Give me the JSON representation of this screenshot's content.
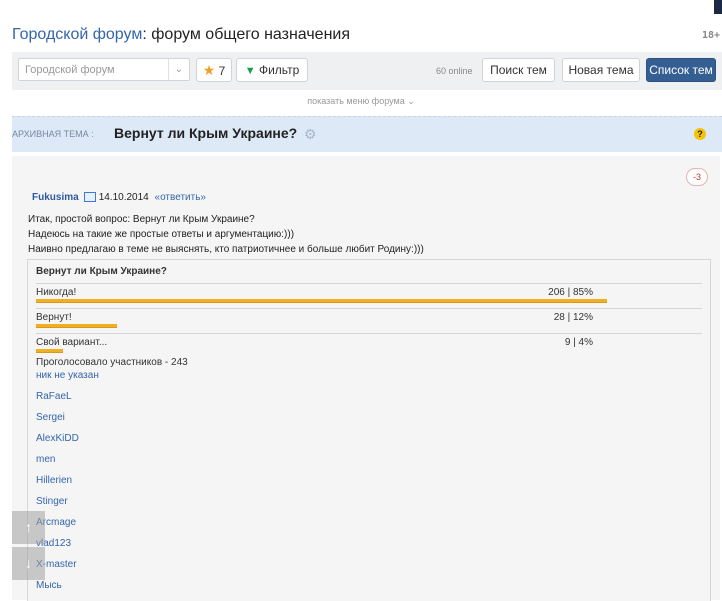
{
  "header": {
    "forum_link": "Городской форум",
    "separator": ":",
    "subtitle": "форум общего назначения",
    "age": "18+"
  },
  "toolbar": {
    "forum_select_value": "Городской форум",
    "favorites_count": "7",
    "filter_label": "Фильтр",
    "online": "60 online",
    "search_label": "Поиск тем",
    "new_topic_label": "Новая тема",
    "topic_list_label": "Список тем"
  },
  "show_menu": "показать меню форума",
  "topic": {
    "archive_label": "АРХИВНАЯ ТЕМА :",
    "title": "Вернут ли Крым Украине?",
    "help": "?"
  },
  "post": {
    "rating": "-3",
    "author": "Fukusima",
    "date": "14.10.2014",
    "reply": "«ответить»",
    "lines": [
      "Итак, простой вопрос: Вернут ли Крым Украине?",
      "Надеюсь на такие же простые ответы и аргументацию:)))",
      "Наивно предлагаю в теме не выяснять, кто патриотичнее и больше любит Родину:)))"
    ]
  },
  "poll": {
    "question": "Вернут ли Крым Украине?",
    "options": [
      {
        "label": "Никогда!",
        "result": "206 | 85%",
        "percent": 85
      },
      {
        "label": "Вернут!",
        "result": "28 | 12%",
        "percent": 12
      },
      {
        "label": "Свой вариант...",
        "result": "9 | 4%",
        "percent": 4
      }
    ],
    "voted": "Проголосовало участников - 243",
    "voters": [
      "ник не указан",
      "RaFaeL",
      "Sergei",
      "AlexKiDD",
      "men",
      "Hillerien",
      "Stinger",
      "Arcmage",
      "vlad123",
      "X-master",
      "Мысь"
    ]
  },
  "icons": {
    "star": "star-icon",
    "filter": "filter-icon",
    "gear": "gear-icon",
    "mail": "mail-icon",
    "scroll_up": "arrow-up-icon",
    "scroll_down": "arrow-down-icon"
  },
  "colors": {
    "accent": "#355f93",
    "link": "#3366aa",
    "topic_bg": "#dde9f7",
    "bar": "#f0b021"
  }
}
